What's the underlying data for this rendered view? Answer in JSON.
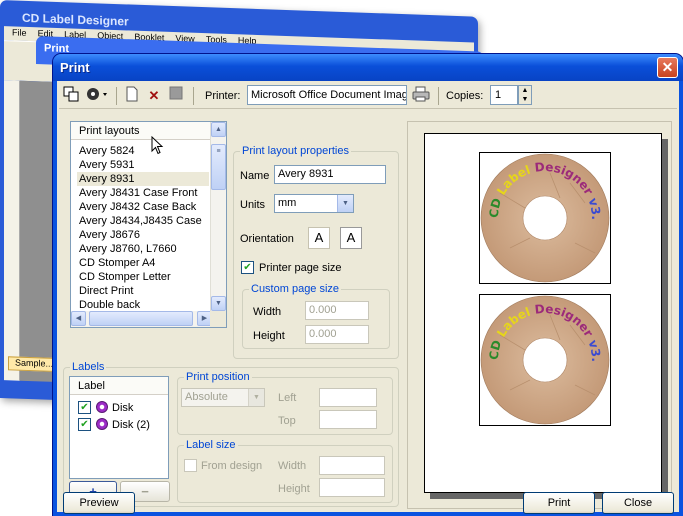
{
  "background_app": {
    "title": "CD Label Designer",
    "menu": [
      "File",
      "Edit",
      "Label",
      "Object",
      "Booklet",
      "View",
      "Tools",
      "Help"
    ],
    "child_title": "Print",
    "tab": "Sample..."
  },
  "dialog": {
    "title": "Print",
    "close_glyph": "✕"
  },
  "toolbar": {
    "printer_label": "Printer:",
    "printer_value": "Microsoft Office Document Image Writer",
    "copies_label": "Copies:",
    "copies_value": "1"
  },
  "layouts": {
    "header": "Print layouts",
    "items": [
      "Avery 5824",
      "Avery 5931",
      "Avery 8931",
      "Avery J8431 Case Front",
      "Avery J8432 Case Back",
      "Avery J8434,J8435 Case",
      "Avery J8676",
      "Avery J8760, L7660",
      "CD Stomper A4",
      "CD Stomper Letter",
      "Direct Print",
      "Double back"
    ],
    "selected": "Avery 8931"
  },
  "properties": {
    "legend": "Print layout properties",
    "name_label": "Name",
    "name_value": "Avery 8931",
    "units_label": "Units",
    "units_value": "mm",
    "orientation_label": "Orientation",
    "printer_page_size_label": "Printer page size",
    "printer_page_size_checked": true,
    "custom_legend": "Custom page size",
    "width_label": "Width",
    "width_value": "0.000",
    "height_label": "Height",
    "height_value": "0.000"
  },
  "labels": {
    "legend": "Labels",
    "header": "Label",
    "items": [
      "Disk",
      "Disk (2)"
    ],
    "add_glyph": "+",
    "remove_glyph": "−"
  },
  "print_position": {
    "legend": "Print position",
    "mode_value": "Absolute",
    "left_label": "Left",
    "top_label": "Top"
  },
  "label_size": {
    "legend": "Label size",
    "from_design_label": "From design",
    "width_label": "Width",
    "height_label": "Height"
  },
  "preview": {
    "disc_text_1": "CD Label Designer v3.0",
    "disc_text_2": "CD Label Designer v3.0"
  },
  "buttons": {
    "preview": "Preview",
    "print": "Print",
    "close": "Close"
  }
}
